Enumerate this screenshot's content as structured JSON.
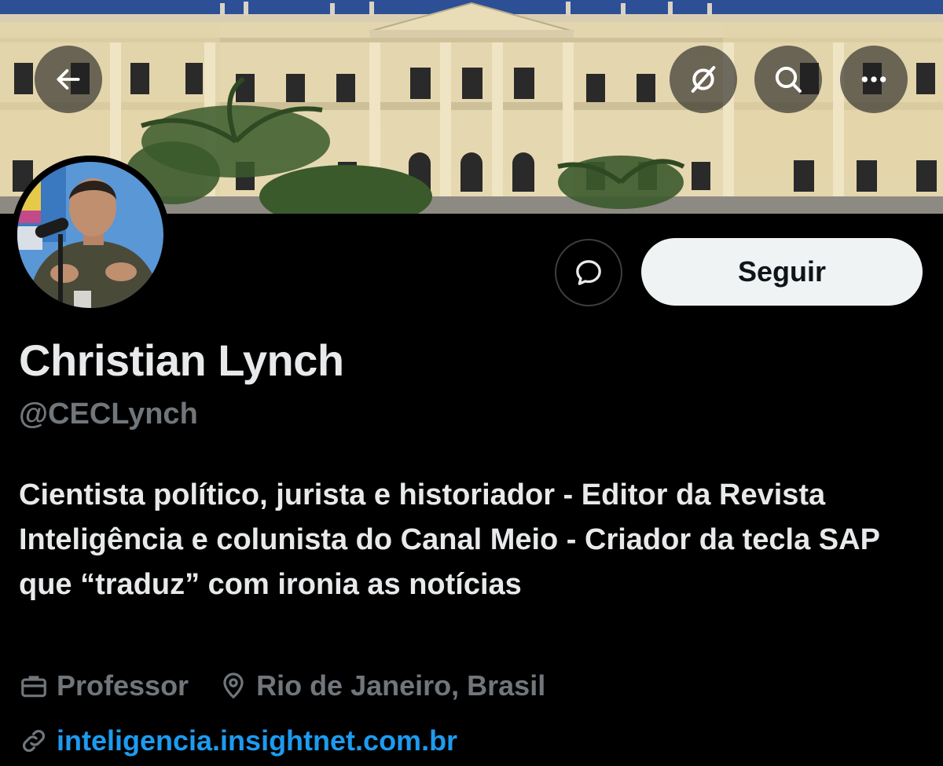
{
  "header": {
    "back_icon": "arrow-left-icon",
    "grok_icon": "grok-icon",
    "search_icon": "search-icon",
    "more_icon": "more-dots-icon"
  },
  "profile": {
    "name": "Christian Lynch",
    "handle": "@CECLynch",
    "bio": "Cientista político, jurista e historiador - Editor da Revista Inteligência e colunista do Canal Meio - Criador da tecla SAP que “traduz” com ironia as notícias",
    "occupation": "Professor",
    "location": "Rio de Janeiro, Brasil",
    "website": "inteligencia.insightnet.com.br"
  },
  "actions": {
    "message_icon": "message-bubble-icon",
    "follow_label": "Seguir"
  },
  "colors": {
    "background": "#000000",
    "primary_text": "#e7e9ea",
    "secondary_text": "#71767b",
    "link": "#1d9bf0",
    "follow_button_bg": "#eff3f4"
  }
}
